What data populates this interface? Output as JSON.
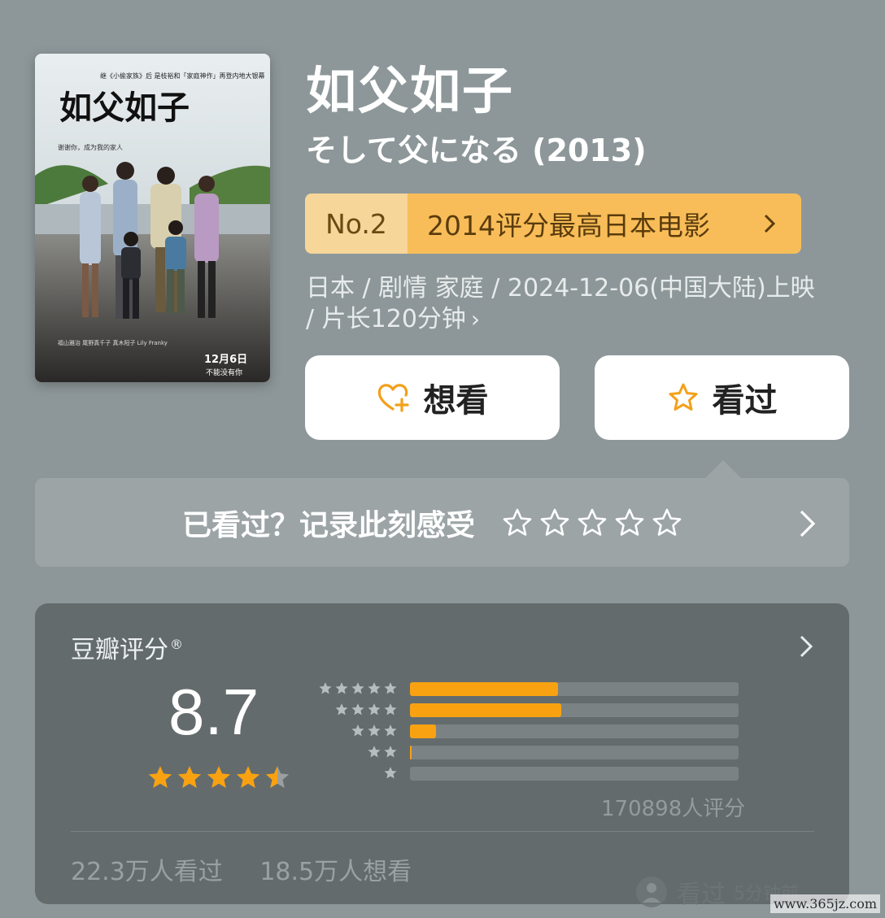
{
  "movie": {
    "title": "如父如子",
    "subtitle": "そして父になる (2013)"
  },
  "rank": {
    "number": "No.2",
    "label": "2014评分最高日本电影"
  },
  "meta": {
    "line": "日本 / 剧情 家庭 / 2024-12-06(中国大陆)上映 / 片长120分钟"
  },
  "actions": {
    "want_label": "想看",
    "seen_label": "看过"
  },
  "record": {
    "label": "已看过？记录此刻感受"
  },
  "poster": {
    "top_line": "继《小偷家族》后 是枝裕和「家庭神作」再登内地大银幕",
    "title": "如父如子",
    "tagline": "谢谢你，成为我的家人",
    "date": "12月6日",
    "slogan": "不能没有你",
    "cast": "福山雅治  尾野真千子  真木阳子  Lily Franky"
  },
  "rating": {
    "header": "豆瓣评分",
    "score": "8.7",
    "score_stars": 4.5,
    "distribution": [
      {
        "stars": 5,
        "fraction": 0.45
      },
      {
        "stars": 4,
        "fraction": 0.46
      },
      {
        "stars": 3,
        "fraction": 0.08
      },
      {
        "stars": 2,
        "fraction": 0.005
      },
      {
        "stars": 1,
        "fraction": 0.0
      }
    ],
    "count_text": "170898人评分",
    "watched": "22.3万人看过",
    "wanted": "18.5万人想看"
  },
  "watermark": {
    "label": "看过",
    "time": "5分钟前",
    "site": "www.365jz.com"
  },
  "colors": {
    "background": "#8d9799",
    "accent_orange": "#f8a212",
    "rank_bg": "#f8bd59",
    "card_bg": "#646b6d"
  }
}
